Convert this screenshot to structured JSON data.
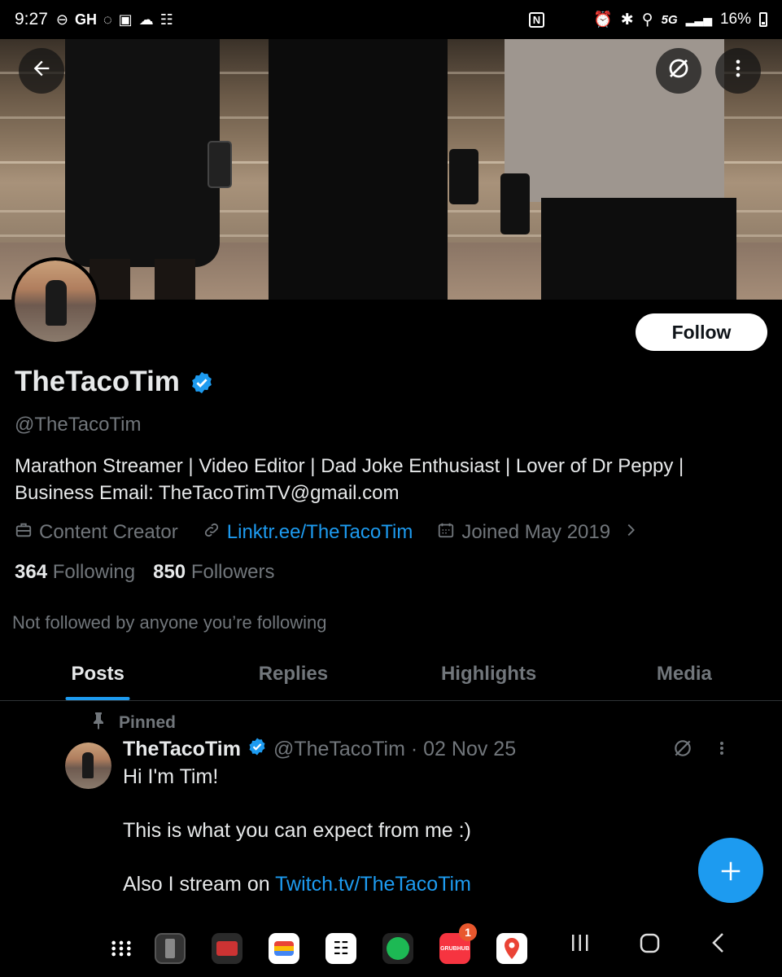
{
  "status_bar": {
    "time": "9:27",
    "left_icons": [
      "do-not-disturb-icon",
      "gh-label",
      "sync-icon",
      "gallery-icon",
      "cloud-icon",
      "app-icon"
    ],
    "gh_label": "GH",
    "network": "5G",
    "battery": "16%"
  },
  "header": {
    "back_icon": "arrow-left-icon",
    "grok_icon": "grok-icon",
    "more_icon": "more-vertical-icon"
  },
  "profile": {
    "display_name": "TheTacoTim",
    "handle": "@TheTacoTim",
    "follow_label": "Follow",
    "bio_line1": "Marathon Streamer | Video Editor | Dad Joke Enthusiast | Lover of Dr Peppy |",
    "bio_line2": "Business Email: TheTacoTimTV@gmail.com",
    "category": "Content Creator",
    "link": "Linktr.ee/TheTacoTim",
    "joined": "Joined May 2019",
    "following_count": "364",
    "following_label": "Following",
    "followers_count": "850",
    "followers_label": "Followers",
    "not_followed": "Not followed by anyone you’re following"
  },
  "tabs": [
    {
      "label": "Posts",
      "active": true
    },
    {
      "label": "Replies",
      "active": false
    },
    {
      "label": "Highlights",
      "active": false
    },
    {
      "label": "Media",
      "active": false
    }
  ],
  "post": {
    "pinned_label": "Pinned",
    "author": "TheTacoTim",
    "meta": "@TheTacoTim · 02 Nov 25",
    "line1": "Hi I'm Tim!",
    "line2": "This is what you can expect from me :)",
    "line3_prefix": "Also I stream on ",
    "line3_link": "Twitch.tv/TheTacoTim"
  },
  "fab_icon": "plus-icon",
  "nav_bar": {
    "apps": [
      "app-drawer-icon",
      "phone-app",
      "video-app",
      "wallet-app",
      "sketch-app",
      "spotify-app",
      "grubhub-app",
      "maps-app"
    ],
    "grubhub_badge": "1",
    "grubhub_label": "GRUBHUB",
    "system": [
      "recents-icon",
      "home-icon",
      "back-icon"
    ]
  },
  "colors": {
    "accent": "#1d9bf0",
    "background": "#000000",
    "text_primary": "#e7e9ea",
    "text_secondary": "#71767b"
  }
}
